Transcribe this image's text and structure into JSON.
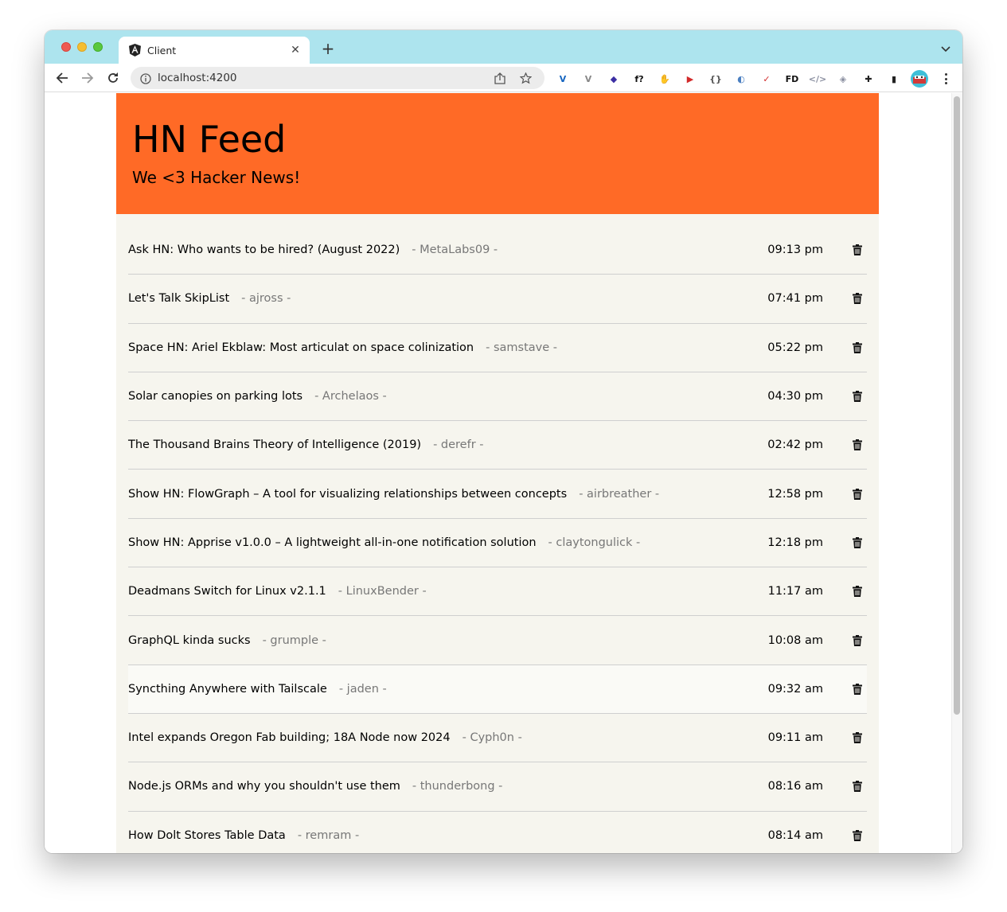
{
  "browser": {
    "tab_title": "Client",
    "tab_close": "✕",
    "new_tab": "+",
    "url": "localhost:4200",
    "extensions": [
      {
        "name": "vue-devtools-icon",
        "glyph": "V",
        "color": "#1565c0"
      },
      {
        "name": "vue-devtools-grey-icon",
        "glyph": "V",
        "color": "#888888"
      },
      {
        "name": "graduation-cap-icon",
        "glyph": "◆",
        "color": "#3b2ea3"
      },
      {
        "name": "font-finder-icon",
        "glyph": "f?",
        "color": "#111111"
      },
      {
        "name": "adblock-icon",
        "glyph": "✋",
        "color": "#d22a2a"
      },
      {
        "name": "video-speed-icon",
        "glyph": "▶",
        "color": "#d22a2a"
      },
      {
        "name": "json-viewer-icon",
        "glyph": "{}",
        "color": "#555555"
      },
      {
        "name": "lighthouse-icon",
        "glyph": "◐",
        "color": "#4a7fc1"
      },
      {
        "name": "todo-check-icon",
        "glyph": "✓",
        "color": "#d22a2a"
      },
      {
        "name": "fd-icon",
        "glyph": "FD",
        "color": "#111111"
      },
      {
        "name": "code-icon",
        "glyph": "</>",
        "color": "#8a8fa0"
      },
      {
        "name": "shield-icon",
        "glyph": "◈",
        "color": "#8a8fa0"
      },
      {
        "name": "puzzle-icon",
        "glyph": "✚",
        "color": "#222222"
      },
      {
        "name": "sidepanel-icon",
        "glyph": "▮",
        "color": "#222222"
      }
    ]
  },
  "app": {
    "title": "HN Feed",
    "subtitle": "We <3 Hacker News!"
  },
  "feed": {
    "items": [
      {
        "title": "Ask HN: Who wants to be hired? (August 2022)",
        "author": "- MetaLabs09 -",
        "time": "09:13 pm"
      },
      {
        "title": "Let's Talk SkipList",
        "author": "- ajross -",
        "time": "07:41 pm"
      },
      {
        "title": "Space HN: Ariel Ekblaw: Most articulat on space colinization",
        "author": "- samstave -",
        "time": "05:22 pm"
      },
      {
        "title": "Solar canopies on parking lots",
        "author": "- Archelaos -",
        "time": "04:30 pm"
      },
      {
        "title": "The Thousand Brains Theory of Intelligence (2019)",
        "author": "- derefr -",
        "time": "02:42 pm"
      },
      {
        "title": "Show HN: FlowGraph – A tool for visualizing relationships between concepts",
        "author": "- airbreather -",
        "time": "12:58 pm"
      },
      {
        "title": "Show HN: Apprise v1.0.0 – A lightweight all-in-one notification solution",
        "author": "- claytongulick -",
        "time": "12:18 pm"
      },
      {
        "title": "Deadmans Switch for Linux v2.1.1",
        "author": "- LinuxBender -",
        "time": "11:17 am"
      },
      {
        "title": "GraphQL kinda sucks",
        "author": "- grumple -",
        "time": "10:08 am"
      },
      {
        "title": "Syncthing Anywhere with Tailscale",
        "author": "- jaden -",
        "time": "09:32 am"
      },
      {
        "title": "Intel expands Oregon Fab building; 18A Node now 2024",
        "author": "- Cyph0n -",
        "time": "09:11 am"
      },
      {
        "title": "Node.js ORMs and why you shouldn't use them",
        "author": "- thunderbong -",
        "time": "08:16 am"
      },
      {
        "title": "How Dolt Stores Table Data",
        "author": "- remram -",
        "time": "08:14 am"
      }
    ]
  },
  "colors": {
    "header": "#ff6a26",
    "feed_background": "#f6f5ee",
    "tabbar": "#ade4ee"
  }
}
